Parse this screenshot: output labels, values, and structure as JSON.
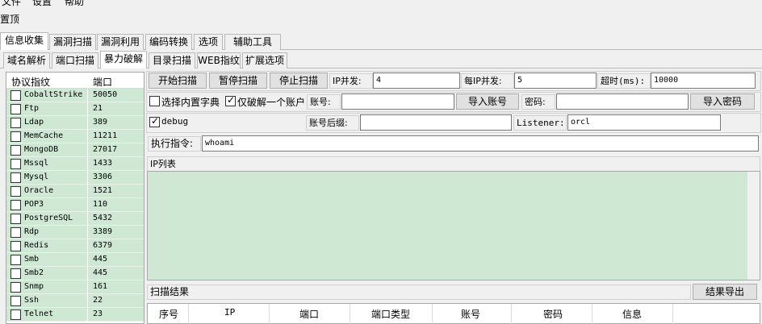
{
  "menu": {
    "file": "文件",
    "settings": "设置",
    "help": "帮助"
  },
  "top_label": "置顶",
  "main_tabs": [
    "信息收集",
    "漏洞扫描",
    "漏洞利用",
    "编码转换",
    "选项",
    "辅助工具"
  ],
  "sub_tabs": [
    "域名解析",
    "端口扫描",
    "暴力破解",
    "目录扫描",
    "WEB指纹",
    "扩展选项"
  ],
  "protocol_table": {
    "headers": [
      "协议指纹",
      "端口"
    ],
    "rows": [
      [
        "CobaltStrike",
        "50050"
      ],
      [
        "Ftp",
        "21"
      ],
      [
        "Ldap",
        "389"
      ],
      [
        "MemCache",
        "11211"
      ],
      [
        "MongoDB",
        "27017"
      ],
      [
        "Mssql",
        "1433"
      ],
      [
        "Mysql",
        "3306"
      ],
      [
        "Oracle",
        "1521"
      ],
      [
        "POP3",
        "110"
      ],
      [
        "PostgreSQL",
        "5432"
      ],
      [
        "Rdp",
        "3389"
      ],
      [
        "Redis",
        "6379"
      ],
      [
        "Smb",
        "445"
      ],
      [
        "Smb2",
        "445"
      ],
      [
        "Snmp",
        "161"
      ],
      [
        "Ssh",
        "22"
      ],
      [
        "Telnet",
        "23"
      ]
    ]
  },
  "controls": {
    "start_scan": "开始扫描",
    "pause_scan": "暂停扫描",
    "stop_scan": "停止扫描",
    "ip_concurrency_label": "IP并发:",
    "ip_concurrency": "4",
    "per_ip_concurrency_label": "每IP并发:",
    "per_ip_concurrency": "5",
    "timeout_label": "超时(ms):",
    "timeout": "10000",
    "builtin_dict": "选择内置字典",
    "crack_one_only": "仅破解一个账户",
    "account_label": "账号:",
    "account_value": "",
    "import_account": "导入账号",
    "password_label": "密码:",
    "password_value": "",
    "import_password": "导入密码",
    "debug": "debug",
    "account_suffix_label": "账号后缀:",
    "account_suffix": "",
    "listener_label": "Listener:",
    "listener": "orcl",
    "exec_label": "执行指令:",
    "exec_cmd": "whoami"
  },
  "ip_list_label": "IP列表",
  "scan_results_label": "扫描结果",
  "export_results": "结果导出",
  "result_columns": [
    "序号",
    "IP",
    "端口",
    "端口类型",
    "账号",
    "密码",
    "信息"
  ]
}
